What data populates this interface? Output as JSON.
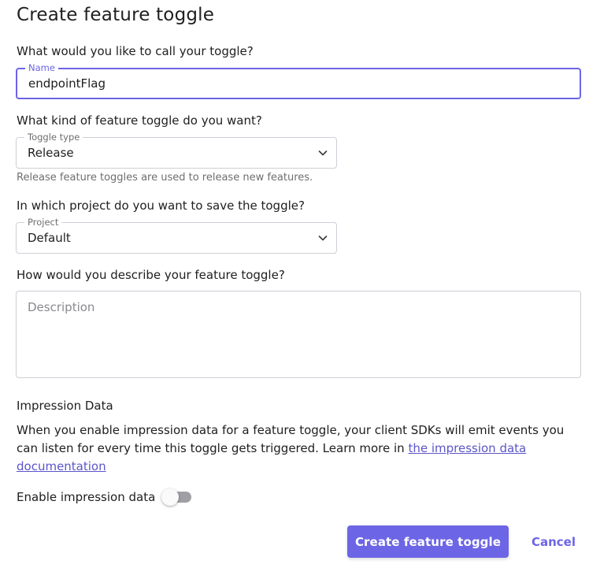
{
  "page": {
    "title": "Create feature toggle"
  },
  "name_section": {
    "question": "What would you like to call your toggle?",
    "label": "Name",
    "value": "endpointFlag"
  },
  "type_section": {
    "question": "What kind of feature toggle do you want?",
    "label": "Toggle type",
    "value": "Release",
    "helper": "Release feature toggles are used to release new features.",
    "icon": "chevron-down-icon"
  },
  "project_section": {
    "question": "In which project do you want to save the toggle?",
    "label": "Project",
    "value": "Default",
    "icon": "chevron-down-icon"
  },
  "description_section": {
    "question": "How would you describe your feature toggle?",
    "placeholder": "Description"
  },
  "impression_section": {
    "title": "Impression Data",
    "text": "When you enable impression data for a feature toggle, your client SDKs will emit events you can listen for every time this toggle gets triggered. Learn more in ",
    "link_text": "the impression data documentation",
    "switch_label": "Enable impression data",
    "switch_on": false
  },
  "actions": {
    "submit_label": "Create feature toggle",
    "cancel_label": "Cancel"
  },
  "colors": {
    "primary": "#6c65e5",
    "text": "#202021",
    "muted": "#6e6e70",
    "border": "#cfcfd6"
  }
}
